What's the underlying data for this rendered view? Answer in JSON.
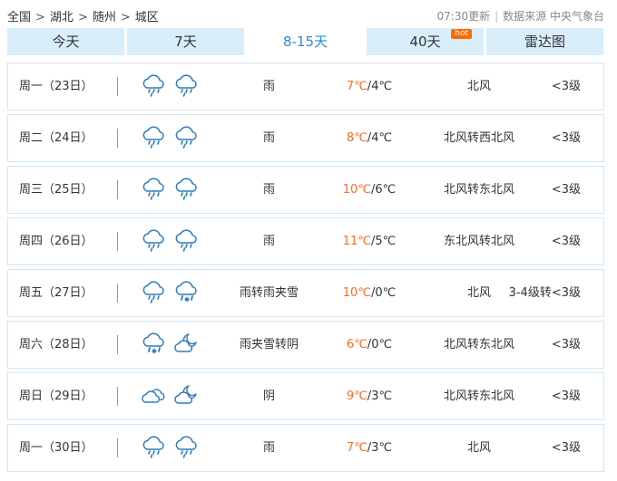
{
  "breadcrumb": [
    "全国",
    "湖北",
    "随州",
    "城区"
  ],
  "breadcrumb_separator": ">",
  "update_time": "07:30更新",
  "source_label": "数据来源 中央气象台",
  "source_separator": "|",
  "tabs": [
    {
      "label": "今天",
      "active": false
    },
    {
      "label": "7天",
      "active": false
    },
    {
      "label": "8-15天",
      "active": true
    },
    {
      "label": "40天",
      "active": false,
      "badge": "hot"
    },
    {
      "label": "雷达图",
      "active": false
    }
  ],
  "colors": {
    "accent": "#2a8ad4",
    "high_temp": "#ff6a1f",
    "hot_badge": "#ff6a00",
    "tab_bg": "#d8eefb",
    "row_border": "#cfe6f7",
    "icon_stroke": "#2e7bbf"
  },
  "days": [
    {
      "date": "周一（23日）",
      "icons": [
        "rain-icon",
        "rain-icon"
      ],
      "condition": "雨",
      "high": "7℃",
      "low": "4℃",
      "wind": "北风",
      "level": "<3级"
    },
    {
      "date": "周二（24日）",
      "icons": [
        "rain-icon",
        "rain-icon"
      ],
      "condition": "雨",
      "high": "8℃",
      "low": "4℃",
      "wind": "北风转西北风",
      "level": "<3级"
    },
    {
      "date": "周三（25日）",
      "icons": [
        "rain-icon",
        "rain-icon"
      ],
      "condition": "雨",
      "high": "10℃",
      "low": "6℃",
      "wind": "北风转东北风",
      "level": "<3级"
    },
    {
      "date": "周四（26日）",
      "icons": [
        "rain-icon",
        "rain-icon"
      ],
      "condition": "雨",
      "high": "11℃",
      "low": "5℃",
      "wind": "东北风转北风",
      "level": "<3级"
    },
    {
      "date": "周五（27日）",
      "icons": [
        "rain-icon",
        "sleet-icon"
      ],
      "condition": "雨转雨夹雪",
      "high": "10℃",
      "low": "0℃",
      "wind": "北风",
      "level": "3-4级转<3级"
    },
    {
      "date": "周六（28日）",
      "icons": [
        "sleet-icon",
        "cloudy-night-icon"
      ],
      "condition": "雨夹雪转阴",
      "high": "6℃",
      "low": "0℃",
      "wind": "北风转东北风",
      "level": "<3级"
    },
    {
      "date": "周日（29日）",
      "icons": [
        "overcast-icon",
        "cloudy-night-icon"
      ],
      "condition": "阴",
      "high": "9℃",
      "low": "3℃",
      "wind": "北风转东北风",
      "level": "<3级"
    },
    {
      "date": "周一（30日）",
      "icons": [
        "rain-icon",
        "rain-icon"
      ],
      "condition": "雨",
      "high": "7℃",
      "low": "3℃",
      "wind": "北风",
      "level": "<3级"
    }
  ]
}
